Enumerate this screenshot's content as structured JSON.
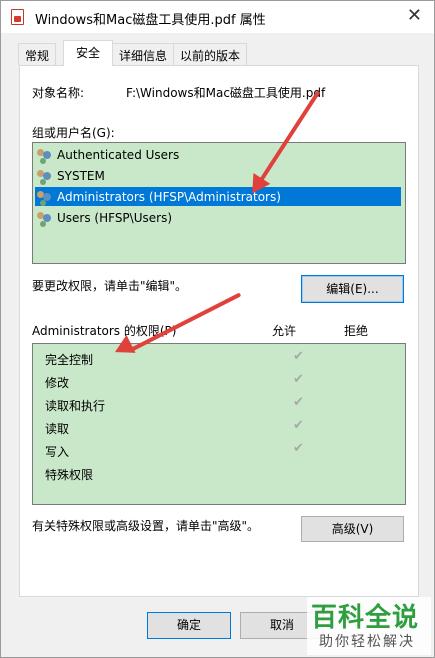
{
  "window": {
    "title": "Windows和Mac磁盘工具使用.pdf 属性",
    "close_glyph": "✕"
  },
  "tabs": [
    {
      "label": "常规",
      "active": false
    },
    {
      "label": "安全",
      "active": true
    },
    {
      "label": "详细信息",
      "active": false
    },
    {
      "label": "以前的版本",
      "active": false
    }
  ],
  "object": {
    "label": "对象名称:",
    "value": "F:\\Windows和Mac磁盘工具使用.pdf"
  },
  "groups": {
    "label": "组或用户名(G):",
    "items": [
      {
        "name": "Authenticated Users",
        "selected": false
      },
      {
        "name": "SYSTEM",
        "selected": false
      },
      {
        "name": "Administrators (HFSP\\Administrators)",
        "selected": true
      },
      {
        "name": "Users (HFSP\\Users)",
        "selected": false
      }
    ]
  },
  "edit": {
    "hint": "要更改权限，请单击\"编辑\"。",
    "button": "编辑(E)..."
  },
  "permissions": {
    "title": "Administrators 的权限(P)",
    "col_allow": "允许",
    "col_deny": "拒绝",
    "rows": [
      {
        "name": "完全控制",
        "allow": true
      },
      {
        "name": "修改",
        "allow": true
      },
      {
        "name": "读取和执行",
        "allow": true
      },
      {
        "name": "读取",
        "allow": true
      },
      {
        "name": "写入",
        "allow": true
      },
      {
        "name": "特殊权限",
        "allow": false
      }
    ],
    "check_glyph": "✔"
  },
  "advanced": {
    "hint": "有关特殊权限或高级设置，请单击\"高级\"。",
    "button": "高级(V)"
  },
  "footer": {
    "ok": "确定",
    "cancel": "取消"
  },
  "watermark": {
    "title": "百科全说",
    "subtitle": "助你轻松解决"
  },
  "colors": {
    "list_bg": "#c9e7c9",
    "selection": "#0078d7",
    "arrow": "#e0413a"
  }
}
